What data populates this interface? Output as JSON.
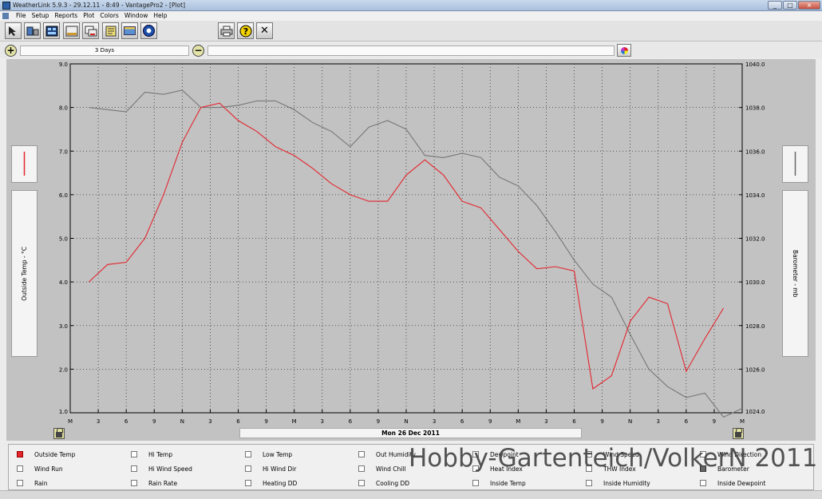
{
  "window": {
    "title": "WeatherLink 5.9.3 - 29.12.11 - 8:49 - VantagePro2 - [Plot]",
    "minimize": "_",
    "maximize": "□",
    "close": "×"
  },
  "menu": [
    "File",
    "Setup",
    "Reports",
    "Plot",
    "Colors",
    "Window",
    "Help"
  ],
  "toolbar": {
    "print_icon": "printer-icon",
    "help_icon": "help-icon",
    "help_glyph": "?",
    "close_icon": "close-icon",
    "close_glyph": "✕"
  },
  "range": {
    "label": "3 Days",
    "zoom_in": "+",
    "zoom_out": "−"
  },
  "axes": {
    "left_label": "Outside Temp - °C",
    "right_label": "Barometer - mb",
    "date_label": "Mon 26 Dec 2011"
  },
  "watermark": "Hobby-Gartenteich/VolkerN 2011",
  "legend": {
    "rows": [
      [
        {
          "label": "Outside Temp",
          "state": "red"
        },
        {
          "label": "Hi Temp",
          "state": "off"
        },
        {
          "label": "Low Temp",
          "state": "off"
        },
        {
          "label": "Out Humidity",
          "state": "off"
        },
        {
          "label": "Dewpoint",
          "state": "off"
        },
        {
          "label": "Wind Speed",
          "state": "off"
        },
        {
          "label": "Wind Direction",
          "state": "off"
        }
      ],
      [
        {
          "label": "Wind Run",
          "state": "off"
        },
        {
          "label": "Hi Wind Speed",
          "state": "off"
        },
        {
          "label": "Hi Wind Dir",
          "state": "off"
        },
        {
          "label": "Wind Chill",
          "state": "off"
        },
        {
          "label": "Heat Index",
          "state": "off"
        },
        {
          "label": "THW Index",
          "state": "off"
        },
        {
          "label": "Barometer",
          "state": "gray"
        }
      ],
      [
        {
          "label": "Rain",
          "state": "off"
        },
        {
          "label": "Rain Rate",
          "state": "off"
        },
        {
          "label": "Heating DD",
          "state": "off"
        },
        {
          "label": "Cooling DD",
          "state": "off"
        },
        {
          "label": "Inside Temp",
          "state": "off"
        },
        {
          "label": "Inside Humidity",
          "state": "off"
        },
        {
          "label": "Inside Dewpoint",
          "state": "off"
        }
      ]
    ]
  },
  "chart_data": {
    "type": "line",
    "x_ticks": [
      "M",
      "3",
      "6",
      "9",
      "N",
      "3",
      "6",
      "9",
      "M",
      "3",
      "6",
      "9",
      "N",
      "3",
      "6",
      "9",
      "M",
      "3",
      "6",
      "9",
      "N",
      "3",
      "6",
      "9",
      "M"
    ],
    "x_unit": "hours",
    "y_left": {
      "ticks": [
        "1.0",
        "2.0",
        "3.0",
        "4.0",
        "5.0",
        "6.0",
        "7.0",
        "8.0",
        "9.0"
      ],
      "ylim": [
        1,
        9
      ]
    },
    "y_right": {
      "ticks": [
        "1024.0",
        "1026.0",
        "1028.0",
        "1030.0",
        "1032.0",
        "1034.0",
        "1036.0",
        "1038.0",
        "1040.0"
      ],
      "ylim": [
        1024,
        1040
      ]
    },
    "grid": true,
    "series": [
      {
        "name": "Outside Temp",
        "axis": "left",
        "color": "#e3262e",
        "x": [
          2,
          4,
          6,
          8,
          10,
          12,
          14,
          16,
          18,
          20,
          22,
          24,
          26,
          28,
          30,
          32,
          34,
          36,
          38,
          40,
          42,
          44,
          46,
          48,
          50,
          52,
          54,
          56,
          58,
          60,
          62,
          64,
          66,
          68,
          70
        ],
        "values": [
          4.0,
          4.4,
          4.45,
          5.0,
          6.0,
          7.2,
          8.0,
          8.1,
          7.7,
          7.45,
          7.1,
          6.9,
          6.6,
          6.25,
          6.0,
          5.85,
          5.85,
          6.45,
          6.8,
          6.45,
          5.85,
          5.7,
          5.2,
          4.7,
          4.3,
          4.35,
          4.25,
          1.55,
          1.85,
          3.1,
          3.65,
          3.5,
          1.95,
          2.7,
          3.4
        ]
      },
      {
        "name": "Barometer",
        "axis": "right",
        "color": "#777777",
        "x": [
          2,
          6,
          8,
          10,
          12,
          14,
          16,
          18,
          20,
          22,
          24,
          26,
          28,
          30,
          32,
          34,
          36,
          38,
          40,
          42,
          44,
          46,
          48,
          50,
          52,
          54,
          56,
          58,
          60,
          62,
          64,
          66,
          68,
          70,
          72
        ],
        "values": [
          1038.0,
          1037.8,
          1038.7,
          1038.6,
          1038.8,
          1038.0,
          1038.0,
          1038.1,
          1038.3,
          1038.3,
          1037.9,
          1037.3,
          1036.9,
          1036.2,
          1037.1,
          1037.4,
          1037.0,
          1035.8,
          1035.7,
          1035.9,
          1035.7,
          1034.8,
          1034.4,
          1033.5,
          1032.3,
          1031.0,
          1029.9,
          1029.3,
          1027.6,
          1026.0,
          1025.2,
          1024.7,
          1024.9,
          1023.8,
          1024.2
        ]
      }
    ]
  }
}
